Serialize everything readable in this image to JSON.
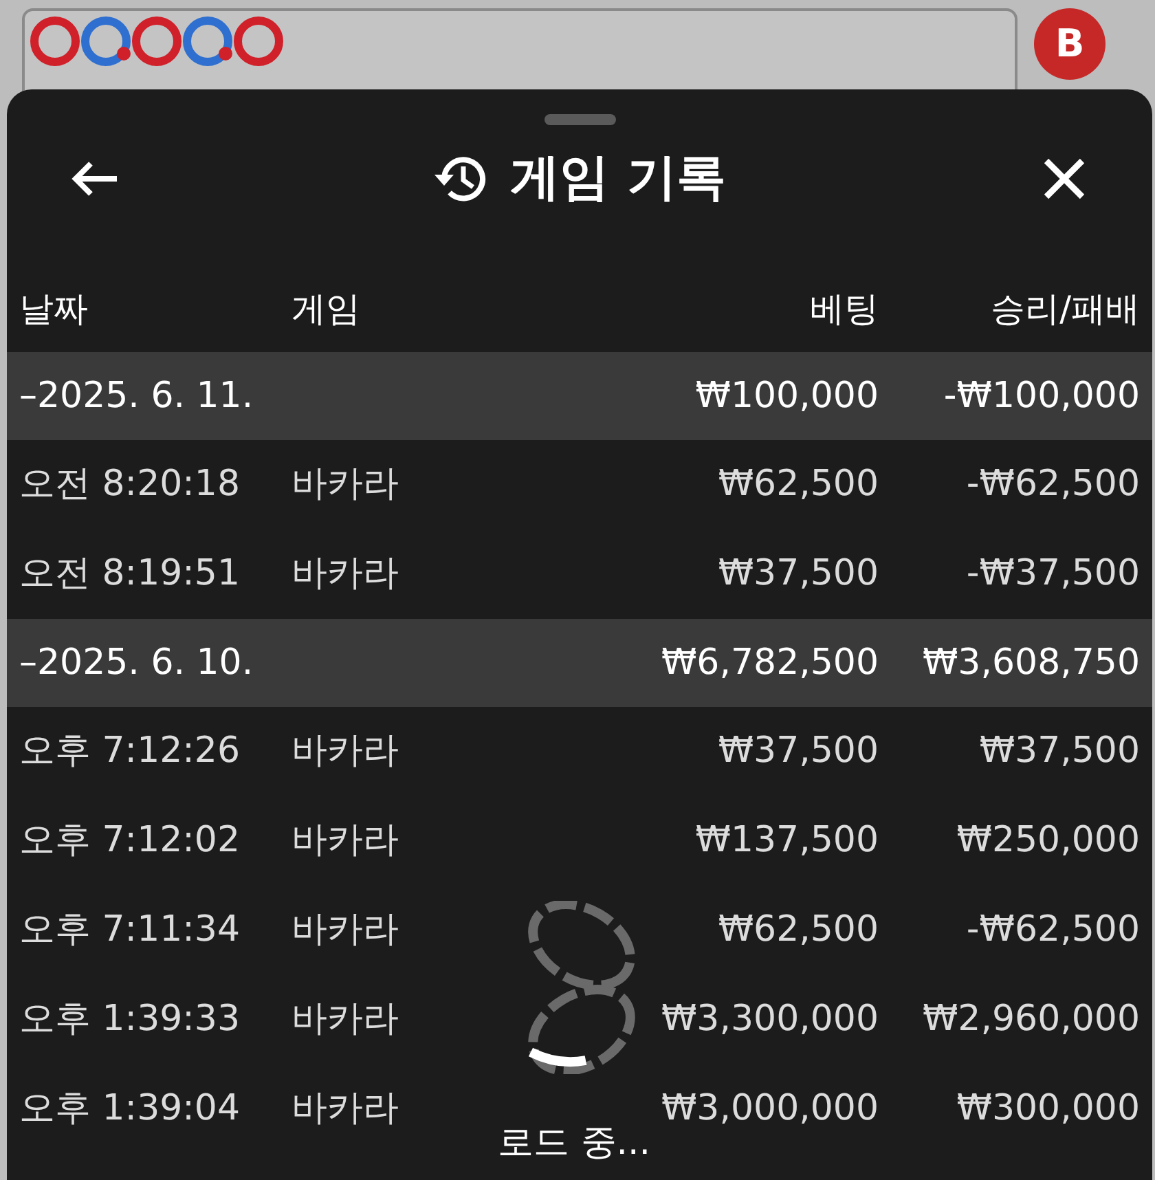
{
  "background": {
    "bead_road": [
      {
        "color": "#d0202a",
        "dot": false
      },
      {
        "color": "#2f6fd0",
        "dot": true
      },
      {
        "color": "#d0202a",
        "dot": false
      },
      {
        "color": "#2f6fd0",
        "dot": true
      },
      {
        "color": "#d0202a",
        "dot": false
      }
    ],
    "badge": "B"
  },
  "sheet": {
    "title": "게임 기록",
    "columns": [
      "날짜",
      "게임",
      "베팅",
      "승리/패배"
    ],
    "groups": [
      {
        "label": "–2025. 6. 11.",
        "bet": "₩100,000",
        "result": "-₩100,000",
        "rows": [
          {
            "time": "오전 8:20:18",
            "game": "바카라",
            "bet": "₩62,500",
            "result": "-₩62,500"
          },
          {
            "time": "오전 8:19:51",
            "game": "바카라",
            "bet": "₩37,500",
            "result": "-₩37,500"
          }
        ]
      },
      {
        "label": "–2025. 6. 10.",
        "bet": "₩6,782,500",
        "result": "₩3,608,750",
        "rows": [
          {
            "time": "오후 7:12:26",
            "game": "바카라",
            "bet": "₩37,500",
            "result": "₩37,500"
          },
          {
            "time": "오후 7:12:02",
            "game": "바카라",
            "bet": "₩137,500",
            "result": "₩250,000"
          },
          {
            "time": "오후 7:11:34",
            "game": "바카라",
            "bet": "₩62,500",
            "result": "-₩62,500"
          },
          {
            "time": "오후 1:39:33",
            "game": "바카라",
            "bet": "₩3,300,000",
            "result": "₩2,960,000"
          },
          {
            "time": "오후 1:39:04",
            "game": "바카라",
            "bet": "₩3,000,000",
            "result": "₩300,000"
          }
        ]
      }
    ],
    "loading": "로드 중..."
  }
}
